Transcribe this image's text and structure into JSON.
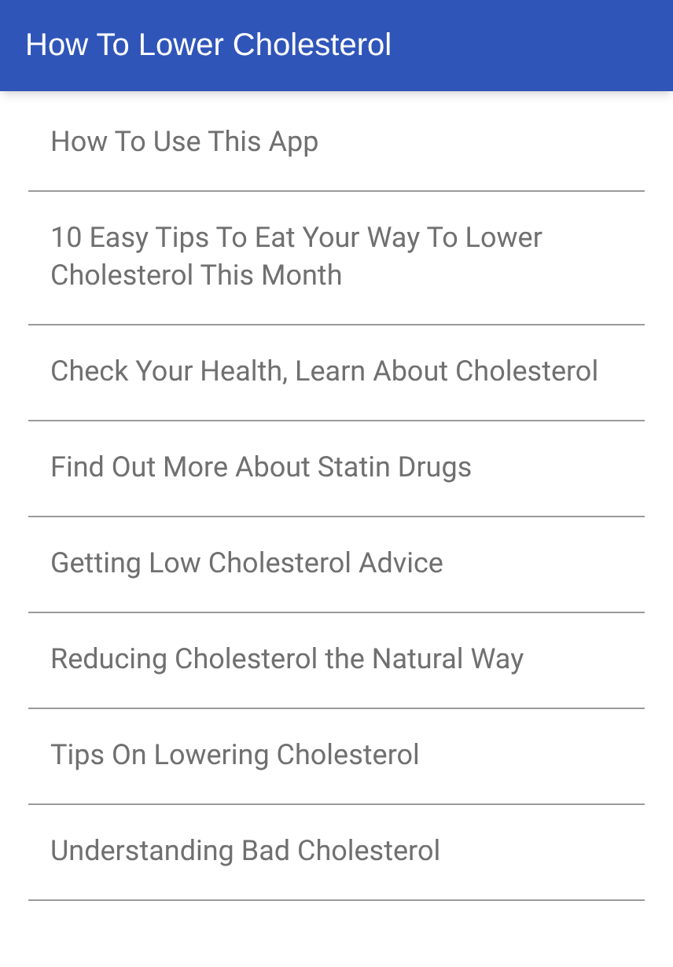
{
  "app_bar": {
    "title": "How To Lower Cholesterol"
  },
  "items": [
    {
      "label": "How To Use This App"
    },
    {
      "label": "10 Easy Tips To Eat Your Way To Lower Cholesterol This Month"
    },
    {
      "label": "Check Your Health, Learn About Cholesterol"
    },
    {
      "label": "Find Out More About Statin Drugs"
    },
    {
      "label": "Getting Low Cholesterol Advice"
    },
    {
      "label": "Reducing Cholesterol the Natural Way"
    },
    {
      "label": "Tips On Lowering Cholesterol"
    },
    {
      "label": "Understanding Bad Cholesterol"
    }
  ]
}
